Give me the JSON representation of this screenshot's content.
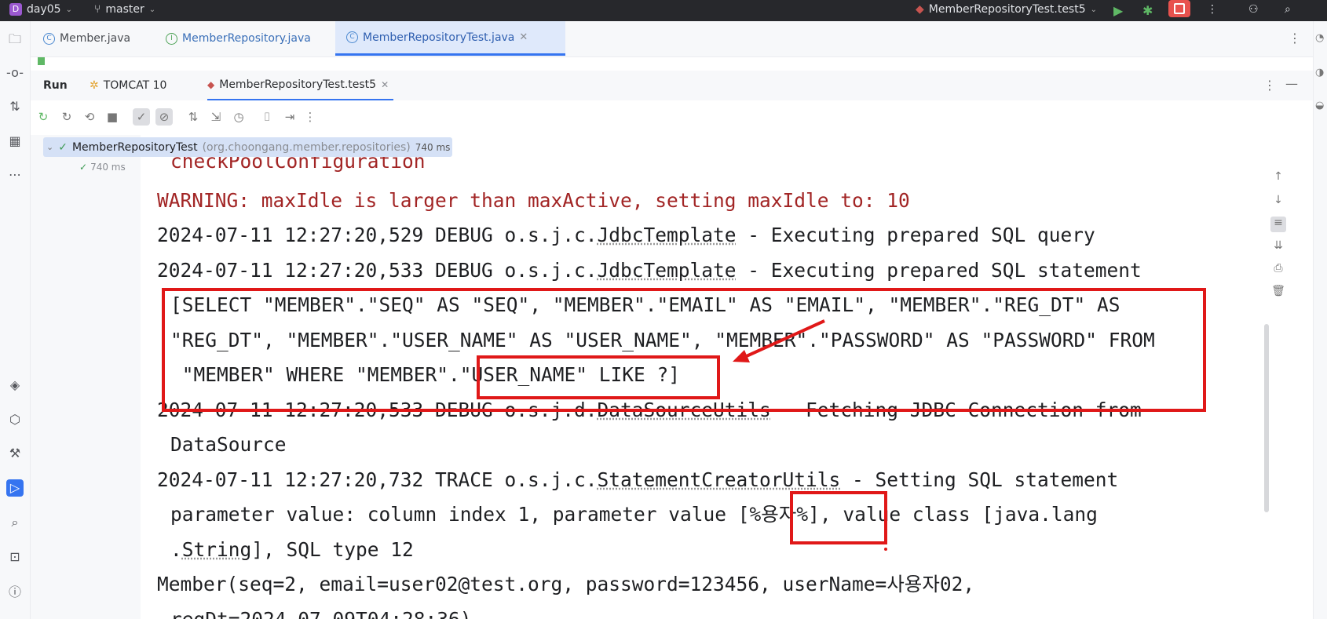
{
  "topbar": {
    "project_badge": "D",
    "project": "day05",
    "branch": "master",
    "run_config": "MemberRepositoryTest.test5"
  },
  "editor_tabs": [
    {
      "label": "Member.java",
      "kind": "class"
    },
    {
      "label": "MemberRepository.java",
      "kind": "interface"
    },
    {
      "label": "MemberRepositoryTest.java",
      "kind": "test-class",
      "selected": true
    }
  ],
  "run_panel": {
    "title": "Run",
    "tabs": [
      {
        "label": "TOMCAT 10"
      },
      {
        "label": "MemberRepositoryTest.test5",
        "selected": true
      }
    ]
  },
  "test_tree": {
    "root_label": "MemberRepositoryTest",
    "root_package": "(org.choongang.member.repositories)",
    "root_time": "740 ms",
    "child_time": "740 ms"
  },
  "console": {
    "lines": [
      {
        "type": "warn",
        "text": "checkPoolConfiguration"
      },
      {
        "type": "warn",
        "text": "WARNING: maxIdle is larger than maxActive, setting maxIdle to: 10"
      },
      {
        "type": "log",
        "prefix": "2024-07-11 12:27:20,529 DEBUG o.s.j.c.",
        "link": "JdbcTemplate",
        "suffix": " - Executing prepared SQL query"
      },
      {
        "type": "log",
        "prefix": "2024-07-11 12:27:20,533 DEBUG o.s.j.c.",
        "link": "JdbcTemplate",
        "suffix": " - Executing prepared SQL statement"
      },
      {
        "type": "cont",
        "text": "[SELECT \"MEMBER\".\"SEQ\" AS \"SEQ\", \"MEMBER\".\"EMAIL\" AS \"EMAIL\", \"MEMBER\".\"REG_DT\" AS"
      },
      {
        "type": "cont",
        "text": "\"REG_DT\", \"MEMBER\".\"USER_NAME\" AS \"USER_NAME\", \"MEMBER\".\"PASSWORD\" AS \"PASSWORD\" FROM"
      },
      {
        "type": "cont",
        "text": " \"MEMBER\" WHERE \"MEMBER\".\"USER_NAME\" LIKE ?]"
      },
      {
        "type": "log",
        "prefix": "2024-07-11 12:27:20,533 DEBUG o.s.j.d.",
        "link": "DataSourceUtils",
        "suffix": " - Fetching JDBC Connection from"
      },
      {
        "type": "cont",
        "text": "DataSource"
      },
      {
        "type": "log",
        "prefix": "2024-07-11 12:27:20,732 TRACE o.s.j.c.",
        "link": "StatementCreatorUtils",
        "suffix": " - Setting SQL statement"
      },
      {
        "type": "cont",
        "text": "parameter value: column index 1, parameter value [%용자%], value class [java.lang"
      },
      {
        "type": "cont2",
        "prefix": ".",
        "link": "String",
        "suffix": "], SQL type 12"
      },
      {
        "type": "plain",
        "text": "Member(seq=2, email=user02@test.org, password=123456, userName=사용자02,"
      },
      {
        "type": "cont",
        "text": "regDt=2024-07-09T04:28:36)"
      }
    ]
  },
  "colors": {
    "annotation": "#e01818",
    "accent": "#3574f0",
    "warning_text": "#a22525"
  }
}
